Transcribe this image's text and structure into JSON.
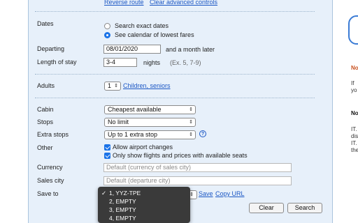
{
  "top_links": {
    "reverse_route": "Reverse route",
    "clear_advanced": "Clear advanced controls"
  },
  "dates": {
    "label": "Dates",
    "option_exact": "Search exact dates",
    "option_calendar": "See calendar of lowest fares",
    "selected": "calendar"
  },
  "departing": {
    "label": "Departing",
    "value": "08/01/2020",
    "suffix": "and a month later"
  },
  "length_of_stay": {
    "label": "Length of stay",
    "value": "3-4",
    "unit": "nights",
    "hint": "(Ex. 5, 7-9)"
  },
  "adults": {
    "label": "Adults",
    "value": "1",
    "children_link": "Children, seniors"
  },
  "cabin": {
    "label": "Cabin",
    "value": "Cheapest available"
  },
  "stops": {
    "label": "Stops",
    "value": "No limit"
  },
  "extra_stops": {
    "label": "Extra stops",
    "value": "Up to 1 extra stop",
    "help": "?"
  },
  "other": {
    "label": "Other",
    "allow_airport_changes": "Allow airport changes",
    "only_available": "Only show flights and prices with available seats"
  },
  "currency": {
    "label": "Currency",
    "placeholder": "Default (currency of sales city)"
  },
  "sales_city": {
    "label": "Sales city",
    "placeholder": "Default (departure city)"
  },
  "save_to": {
    "label": "Save to",
    "save_link": "Save",
    "copy_url_link": "Copy URL",
    "options": [
      {
        "label": "1, YYZ-TPE",
        "checked": "✓"
      },
      {
        "label": "2, EMPTY",
        "checked": ""
      },
      {
        "label": "3, EMPTY",
        "checked": ""
      },
      {
        "label": "4, EMPTY",
        "checked": ""
      }
    ]
  },
  "buttons": {
    "clear": "Clear",
    "search": "Search"
  },
  "right_pane": {
    "heading1": "No",
    "line1": "If",
    "line2": "yo",
    "heading2": "No",
    "p1": "IT.",
    "p2": "dis",
    "p3": "IT.",
    "p4": "the"
  },
  "colors": {
    "panel_bg": "#e7f0fa",
    "link": "#1a56c4",
    "accent": "#1a73e8",
    "orange": "#c8501e"
  }
}
